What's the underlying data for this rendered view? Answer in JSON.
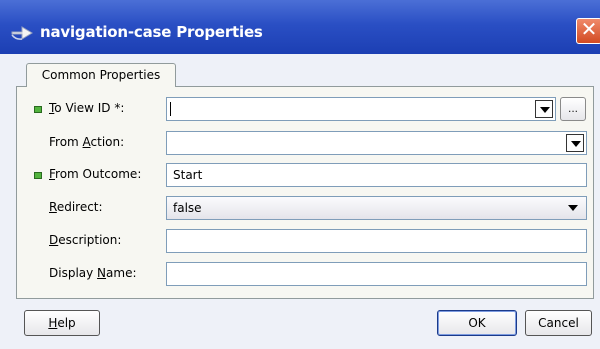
{
  "window": {
    "title": "navigation-case Properties",
    "title_icon": "arrow-right-icon",
    "close_glyph": "✕"
  },
  "tabs": [
    {
      "label": "Common Properties",
      "selected": true
    }
  ],
  "fields": {
    "to_view_id": {
      "pre": "",
      "mnemonic": "T",
      "post": "o View ID *:",
      "value": "",
      "required": true,
      "browse_label": "..."
    },
    "from_action": {
      "pre": "From ",
      "mnemonic": "A",
      "post": "ction:",
      "value": ""
    },
    "from_outcome": {
      "pre": "",
      "mnemonic": "F",
      "post": "rom Outcome:",
      "value": "Start",
      "required": true
    },
    "redirect": {
      "pre": "",
      "mnemonic": "R",
      "post": "edirect:",
      "value": "false"
    },
    "description": {
      "pre": "",
      "mnemonic": "D",
      "post": "escription:",
      "value": ""
    },
    "display_name": {
      "pre": "Display ",
      "mnemonic": "N",
      "post": "ame:",
      "value": ""
    }
  },
  "buttons": {
    "help": {
      "pre": "",
      "mnemonic": "H",
      "post": "elp"
    },
    "ok": "OK",
    "cancel": "Cancel"
  },
  "colors": {
    "title_bar": "#2a4fc4",
    "close": "#d24a22",
    "required_marker": "#52b33e"
  }
}
